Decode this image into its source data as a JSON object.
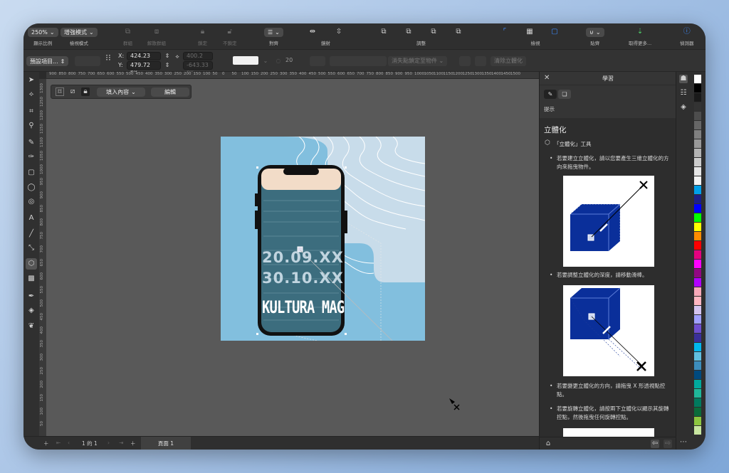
{
  "toolbar": {
    "zoom": {
      "value": "250%",
      "label": "顯示比例"
    },
    "view_mode": {
      "value": "增強模式",
      "label": "檢視模式"
    },
    "group_label": "群組",
    "ungroup_label": "解散群組",
    "lock_label": "鎖定",
    "unlock_label": "不鎖定",
    "align_label": "對齊",
    "mirror_label": "鏡射",
    "adjust_label": "調整",
    "view_label": "檢視",
    "snap_label": "貼齊",
    "get_more_label": "取得更多...",
    "inspector_label": "偵測器"
  },
  "propbar": {
    "preset": "預設項目...",
    "x_label": "X:",
    "x_value": "424.23 px",
    "y_label": "Y:",
    "y_value": "479.72 px",
    "depth_x": "400.2 px",
    "depth_y": "-643.33 px",
    "depth_count": "20",
    "vanishing": "消失點鎖定至物件",
    "clear_extrude": "清除立體化"
  },
  "ruler": {
    "h_ticks": [
      "900",
      "850",
      "800",
      "750",
      "700",
      "650",
      "600",
      "550",
      "500",
      "450",
      "400",
      "350",
      "300",
      "250",
      "200",
      "150",
      "100",
      "50",
      "0",
      "50",
      "100",
      "150",
      "200",
      "250",
      "300",
      "350",
      "400",
      "450",
      "500",
      "550",
      "600",
      "650",
      "700",
      "750",
      "800",
      "850",
      "900",
      "950",
      "1000",
      "1050",
      "1100",
      "1150",
      "1200",
      "1250",
      "1300",
      "1350",
      "1400",
      "1450",
      "1500"
    ],
    "v_ticks": [
      "1300",
      "1250",
      "1200",
      "1150",
      "1100",
      "1050",
      "1000",
      "950",
      "900",
      "850",
      "800",
      "750",
      "700",
      "650",
      "600",
      "550",
      "500",
      "450",
      "400",
      "350",
      "300",
      "250",
      "200",
      "150",
      "100",
      "50"
    ]
  },
  "floatbar": {
    "fill_label": "填入內容",
    "edit_label": "編輯"
  },
  "artwork": {
    "date1": "20.09.XX",
    "date2": "30.10.XX",
    "title": "KULTURA MAG"
  },
  "status": {
    "page_counter": "1 的 1",
    "page_tab": "頁面 1"
  },
  "panel": {
    "title": "學習",
    "hint_label": "提示",
    "heading": "立體化",
    "tool_name": "「立體化」工具",
    "bullets": [
      "若要建立立體化，請以您要產生三維立體化的方向來拖曳物件。",
      "若要調整立體化的深度，請移動滑棒。",
      "若要變更立體化的方向，請拖曳 X 形透視點控點。",
      "若要旋轉立體化，請按兩下立體化以顯示其旋轉控點，然後拖曳任何旋轉控點。"
    ]
  },
  "colors": {
    "page_bg": "#82bfde",
    "cube": "#0a2f9a",
    "accent": "#3d8bff",
    "palette": [
      "#ffffff",
      "#000000",
      "#1a1a1a",
      "#333333",
      "#4d4d4d",
      "#666666",
      "#808080",
      "#999999",
      "#b3b3b3",
      "#cccccc",
      "#e6e6e6",
      "#f2f2f2",
      "#00a0e9",
      "#1d2088",
      "#0000ff",
      "#00ff00",
      "#ffff00",
      "#ff8c00",
      "#ff0000",
      "#e4007f",
      "#ff00ff",
      "#920783",
      "#b200ff",
      "#f7a8b8",
      "#ffb6c1",
      "#d4c4f0",
      "#a0a0ff",
      "#6f4fd0",
      "#3a2f9a",
      "#00b7ee",
      "#60c0e0",
      "#3c8dbc",
      "#004a7f",
      "#00a99d",
      "#1fb89a",
      "#007a5e",
      "#0b6b3a",
      "#8dc63f",
      "#c8e6a0"
    ]
  }
}
